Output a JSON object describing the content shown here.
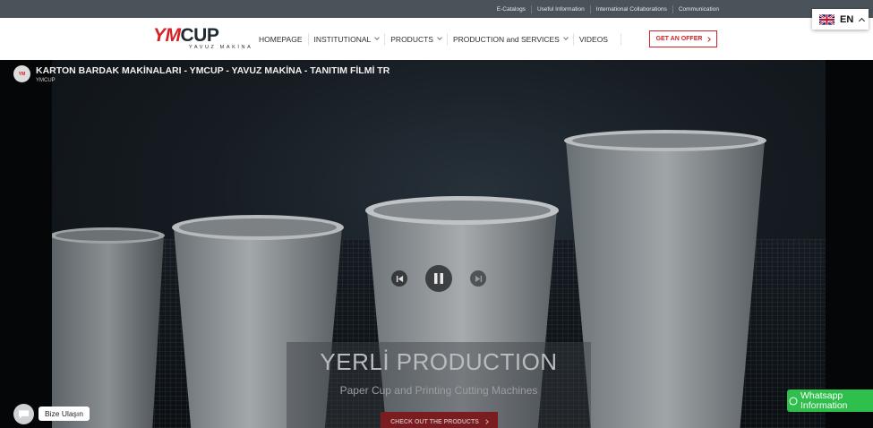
{
  "topbar": {
    "links": [
      "E-Catalogs",
      "Useful Information",
      "International Collaborations",
      "Communication"
    ]
  },
  "header": {
    "logo_main_a": "YM",
    "logo_main_b": "CUP",
    "logo_sub": "YAVUZ MAKİNA",
    "nav": [
      {
        "label": "HOMEPAGE",
        "dropdown": false
      },
      {
        "label": "INSTITUTIONAL",
        "dropdown": true
      },
      {
        "label": "PRODUCTS",
        "dropdown": true
      },
      {
        "label": "PRODUCTION and SERVICES",
        "dropdown": true
      },
      {
        "label": "VIDEOS",
        "dropdown": false
      }
    ],
    "offer_label": "GET AN OFFER"
  },
  "language": {
    "code": "EN",
    "flag_icon": "uk-flag-icon"
  },
  "video": {
    "title": "KARTON BARDAK MAKİNALARI - YMCUP - YAVUZ MAKİNA - TANITIM FİLMİ TR",
    "channel": "YMCUP",
    "caption_title": "YERLİ PRODUCTION",
    "caption_subtitle": "Paper Cup and Printing Cutting Machines",
    "caption_button": "CHECK OUT THE PRODUCTS",
    "state": "playing"
  },
  "chat": {
    "label": "Bize Ulaşın"
  },
  "whatsapp": {
    "line1": "Whatsapp",
    "line2": "Information"
  },
  "colors": {
    "brand_red": "#d42127",
    "whatsapp_green": "#2fbf4c",
    "topbar": "#4a5359"
  }
}
